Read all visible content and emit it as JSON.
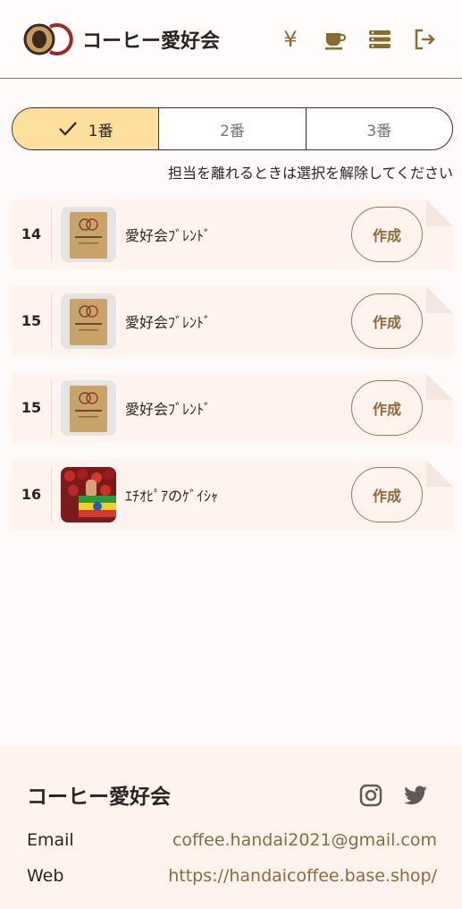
{
  "header": {
    "title": "コーヒー愛好会",
    "nav": [
      {
        "icon": "yen-icon",
        "glyph": "¥"
      },
      {
        "icon": "coffee-cup-icon"
      },
      {
        "icon": "list-icon"
      },
      {
        "icon": "logout-icon"
      }
    ]
  },
  "tabs": [
    {
      "label": "1番",
      "active": true
    },
    {
      "label": "2番",
      "active": false
    },
    {
      "label": "3番",
      "active": false
    }
  ],
  "hint": "担当を離れるときは選択を解除してください",
  "orders": [
    {
      "number": "14",
      "name": "愛好会ﾌﾞﾚﾝﾄﾞ",
      "image": "blend-pack",
      "button": "作成"
    },
    {
      "number": "15",
      "name": "愛好会ﾌﾞﾚﾝﾄﾞ",
      "image": "blend-pack",
      "button": "作成"
    },
    {
      "number": "15",
      "name": "愛好会ﾌﾞﾚﾝﾄﾞ",
      "image": "blend-pack",
      "button": "作成"
    },
    {
      "number": "16",
      "name": "ｴﾁｵﾋﾟｱのｹﾞｲｼｬ",
      "image": "ethiopia-beans",
      "button": "作成"
    }
  ],
  "footer": {
    "title": "コーヒー愛好会",
    "social": [
      "instagram-icon",
      "twitter-icon"
    ],
    "email_label": "Email",
    "email_value": "coffee.handai2021@gmail.com",
    "web_label": "Web",
    "web_value": "https://handaicoffee.base.shop/"
  },
  "colors": {
    "accent": "#8b6a3e",
    "tab_active": "#ffdf9e",
    "row_bg": "#fff3ee"
  }
}
